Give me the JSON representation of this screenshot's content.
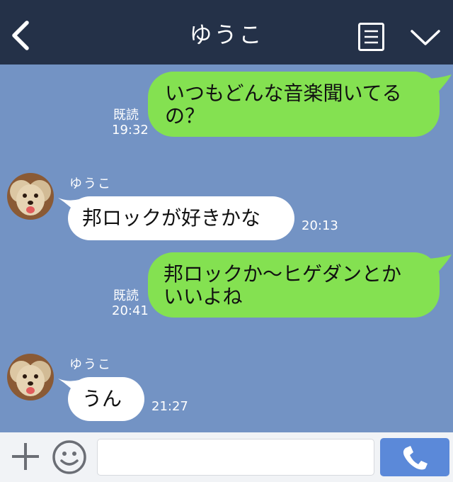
{
  "header": {
    "title": "ゆうこ",
    "back_icon": "chevron-left-icon",
    "memo_icon": "note-icon",
    "menu_icon": "chevron-down-icon"
  },
  "messages": [
    {
      "side": "right",
      "lines": [
        "いつもどんな音楽聞いてる",
        "の？"
      ],
      "read": "既読",
      "time": "19:32"
    },
    {
      "side": "left",
      "sender": "ゆうこ",
      "lines": [
        "邦ロックが好きかな"
      ],
      "time": "20:13"
    },
    {
      "side": "right",
      "lines": [
        "邦ロックか〜ヒゲダンとか",
        "いいよね"
      ],
      "read": "既読",
      "time": "20:41"
    },
    {
      "side": "left",
      "sender": "ゆうこ",
      "lines": [
        "うん"
      ],
      "time": "21:27"
    }
  ],
  "footer": {
    "plus_icon": "plus-icon",
    "emoji_icon": "smiley-icon",
    "input_value": "",
    "call_icon": "phone-icon"
  },
  "colors": {
    "header_bg": "#243148",
    "chat_bg": "#7393c4",
    "bubble_green": "#84e151",
    "bubble_white": "#ffffff",
    "footer_bg": "#f1f3f6",
    "call_button": "#5b89d9"
  }
}
